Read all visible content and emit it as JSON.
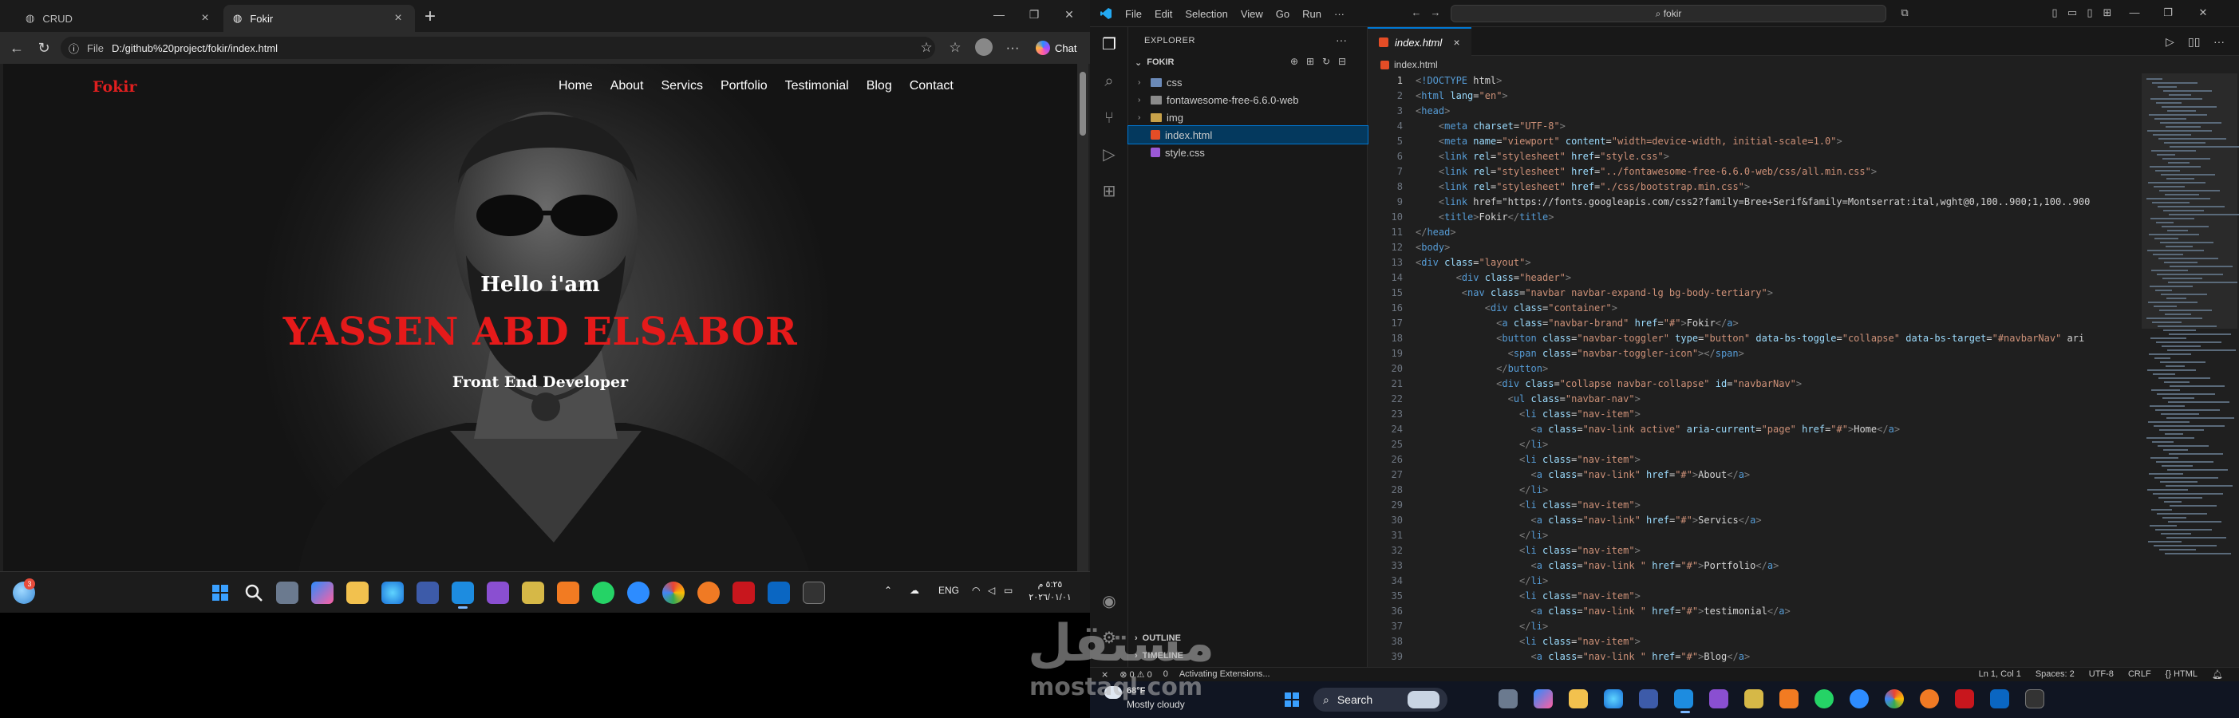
{
  "browser": {
    "tabs": [
      {
        "label": "CRUD"
      },
      {
        "label": "Fokir"
      }
    ],
    "address": {
      "scheme_label": "File",
      "url": "D:/github%20project/fokir/index.html"
    },
    "chat_label": "Chat"
  },
  "site": {
    "brand": "Fokir",
    "nav": [
      "Home",
      "About",
      "Servics",
      "Portfolio",
      "Testimonial",
      "Blog",
      "Contact"
    ],
    "hero": {
      "greeting": "Hello i'am",
      "name": "YASSEN ABD ELSABOR",
      "role": "Front End Developer"
    }
  },
  "taskbar_left": {
    "weather_badge": "3",
    "lang": "ENG",
    "time": "٥:٢٥ م",
    "date": "٢٠٢٦/٠١/٠١"
  },
  "vscode": {
    "menu": [
      "File",
      "Edit",
      "Selection",
      "View",
      "Go",
      "Run",
      "···"
    ],
    "command_search": "fokir",
    "explorer": {
      "title": "EXPLORER",
      "root": "FOKIR",
      "items": [
        {
          "name": "css",
          "kind": "folder"
        },
        {
          "name": "fontawesome-free-6.6.0-web",
          "kind": "folder"
        },
        {
          "name": "img",
          "kind": "folder"
        },
        {
          "name": "index.html",
          "kind": "html",
          "selected": true
        },
        {
          "name": "style.css",
          "kind": "css"
        }
      ],
      "outline": "OUTLINE",
      "timeline": "TIMELINE"
    },
    "editor": {
      "tab": "index.html",
      "breadcrumb": "index.html"
    },
    "code_lines": [
      "<!DOCTYPE html>",
      "<html lang=\"en\">",
      "<head>",
      "    <meta charset=\"UTF-8\">",
      "    <meta name=\"viewport\" content=\"width=device-width, initial-scale=1.0\">",
      "    <link rel=\"stylesheet\" href=\"style.css\">",
      "    <link rel=\"stylesheet\" href=\"../fontawesome-free-6.6.0-web/css/all.min.css\">",
      "    <link rel=\"stylesheet\" href=\"./css/bootstrap.min.css\">",
      "    <link href=\"https://fonts.googleapis.com/css2?family=Bree+Serif&family=Montserrat:ital,wght@0,100..900;1,100..900",
      "    <title>Fokir</title>",
      "</head>",
      "<body>",
      "<div class=\"layout\">",
      "       <div class=\"header\">",
      "        <nav class=\"navbar navbar-expand-lg bg-body-tertiary\">",
      "            <div class=\"container\">",
      "              <a class=\"navbar-brand\" href=\"#\">Fokir</a>",
      "              <button class=\"navbar-toggler\" type=\"button\" data-bs-toggle=\"collapse\" data-bs-target=\"#navbarNav\" ari",
      "                <span class=\"navbar-toggler-icon\"></span>",
      "              </button>",
      "              <div class=\"collapse navbar-collapse\" id=\"navbarNav\">",
      "                <ul class=\"navbar-nav\">",
      "                  <li class=\"nav-item\">",
      "                    <a class=\"nav-link active\" aria-current=\"page\" href=\"#\">Home</a>",
      "                  </li>",
      "                  <li class=\"nav-item\">",
      "                    <a class=\"nav-link\" href=\"#\">About</a>",
      "                  </li>",
      "                  <li class=\"nav-item\">",
      "                    <a class=\"nav-link\" href=\"#\">Servics</a>",
      "                  </li>",
      "                  <li class=\"nav-item\">",
      "                    <a class=\"nav-link \" href=\"#\">Portfolio</a>",
      "                  </li>",
      "                  <li class=\"nav-item\">",
      "                    <a class=\"nav-link \" href=\"#\">testimonial</a>",
      "                  </li>",
      "                  <li class=\"nav-item\">",
      "                    <a class=\"nav-link \" href=\"#\">Blog</a>"
    ],
    "status": {
      "problems": "⊗ 0 ⚠ 0",
      "ports": "0",
      "activity": "Activating Extensions...",
      "position": "Ln 1, Col 1",
      "spaces": "Spaces: 2",
      "encoding": "UTF-8",
      "eol": "CRLF",
      "language": "{} HTML"
    }
  },
  "taskbar_right": {
    "temp": "68°F",
    "weather": "Mostly cloudy",
    "search_label": "Search"
  },
  "watermark": {
    "arabic": "مستقل",
    "latin": "mostaql.com"
  },
  "colors": {
    "accent_red": "#e51a1a",
    "vscode_blue": "#0078d4"
  }
}
